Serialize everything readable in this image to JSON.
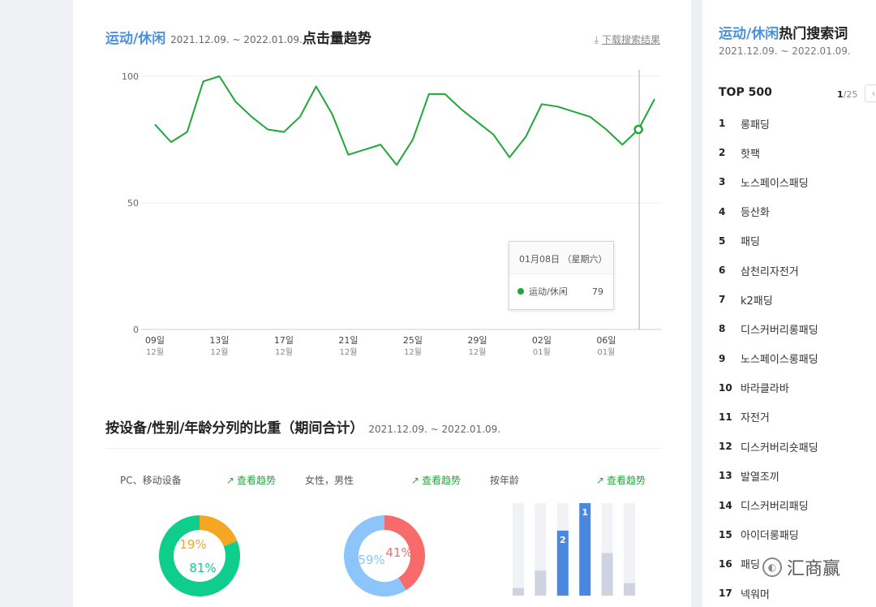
{
  "main": {
    "title": {
      "category": "运动/休闲",
      "date_range": "2021.12.09. ~ 2022.01.09.",
      "suffix": "点击量趋势"
    },
    "download_label": "下载搜索结果",
    "download_icon": "download-icon",
    "tooltip": {
      "date": "01月08日 （星期六）",
      "series_label": "运动/休闲",
      "value": "79"
    },
    "breakdown": {
      "title": "按设备/性别/年龄分列的比重（期间合计）",
      "date_range": "2021.12.09. ~ 2022.01.09.",
      "panels": [
        {
          "title": "PC、移动设备",
          "link": "查看趋势",
          "link_icon": "trend-icon"
        },
        {
          "title": "女性，男性",
          "link": "查看趋势",
          "link_icon": "trend-icon"
        },
        {
          "title": "按年龄",
          "link": "查看趋势",
          "link_icon": "trend-icon"
        }
      ]
    }
  },
  "chart_data": [
    {
      "type": "line",
      "series": [
        {
          "name": "运动/休闲",
          "color": "#1fa83a",
          "values": [
            81,
            74,
            78,
            98,
            100,
            90,
            84,
            79,
            78,
            84,
            96,
            85,
            69,
            71,
            73,
            65,
            75,
            93,
            93,
            87,
            82,
            77,
            68,
            76,
            89,
            88,
            86,
            84,
            79,
            73,
            79,
            91
          ]
        }
      ],
      "x_ticks": [
        {
          "day": "09일",
          "month": "12월"
        },
        {
          "day": "13일",
          "month": "12월"
        },
        {
          "day": "17일",
          "month": "12월"
        },
        {
          "day": "21일",
          "month": "12월"
        },
        {
          "day": "25일",
          "month": "12월"
        },
        {
          "day": "29일",
          "month": "12월"
        },
        {
          "day": "02일",
          "month": "01월"
        },
        {
          "day": "06일",
          "month": "01월"
        }
      ],
      "y_ticks": [
        "100",
        "50",
        "0"
      ],
      "ylim": [
        0,
        100
      ],
      "highlight_index": 30,
      "grid": true
    },
    {
      "type": "pie",
      "title": "PC、移动设备",
      "slices": [
        {
          "label": "19%",
          "value": 19,
          "color": "#f5a623"
        },
        {
          "label": "81%",
          "value": 81,
          "color": "#0fcd8a"
        }
      ]
    },
    {
      "type": "pie",
      "title": "女性，男性",
      "slices": [
        {
          "label": "41%",
          "value": 41,
          "color": "#f76b6b"
        },
        {
          "label": "59%",
          "value": 59,
          "color": "#8cc5fb"
        }
      ]
    },
    {
      "type": "bar",
      "title": "按年龄",
      "values": [
        3,
        10,
        26,
        37,
        17,
        5
      ],
      "highlight": [
        {
          "index": 2,
          "rank": "2",
          "color": "#4a88e0"
        },
        {
          "index": 3,
          "rank": "1",
          "color": "#4a88e0"
        }
      ],
      "ylim": [
        0,
        37
      ]
    }
  ],
  "sidebar": {
    "title_category": "运动/休闲",
    "title_suffix": "热门搜索词",
    "date_range": "2021.12.09. ~ 2022.01.09.",
    "top_label": "TOP 500",
    "page_current": "1",
    "page_total": "/25",
    "prev_icon": "chevron-left-icon",
    "keywords": [
      {
        "rank": "1",
        "text": "롱패딩"
      },
      {
        "rank": "2",
        "text": "핫팩"
      },
      {
        "rank": "3",
        "text": "노스페이스패딩"
      },
      {
        "rank": "4",
        "text": "등산화"
      },
      {
        "rank": "5",
        "text": "패딩"
      },
      {
        "rank": "6",
        "text": "삼천리자전거"
      },
      {
        "rank": "7",
        "text": "k2패딩"
      },
      {
        "rank": "8",
        "text": "디스커버리롱패딩"
      },
      {
        "rank": "9",
        "text": "노스페이스롱패딩"
      },
      {
        "rank": "10",
        "text": "바라클라바"
      },
      {
        "rank": "11",
        "text": "자전거"
      },
      {
        "rank": "12",
        "text": "디스커버리숏패딩"
      },
      {
        "rank": "13",
        "text": "발열조끼"
      },
      {
        "rank": "14",
        "text": "디스커버리패딩"
      },
      {
        "rank": "15",
        "text": "아이더롱패딩"
      },
      {
        "rank": "16",
        "text": "패딩"
      },
      {
        "rank": "17",
        "text": "넥워머"
      }
    ]
  },
  "watermark": {
    "text": "汇商赢",
    "icon": "wechat-icon"
  }
}
